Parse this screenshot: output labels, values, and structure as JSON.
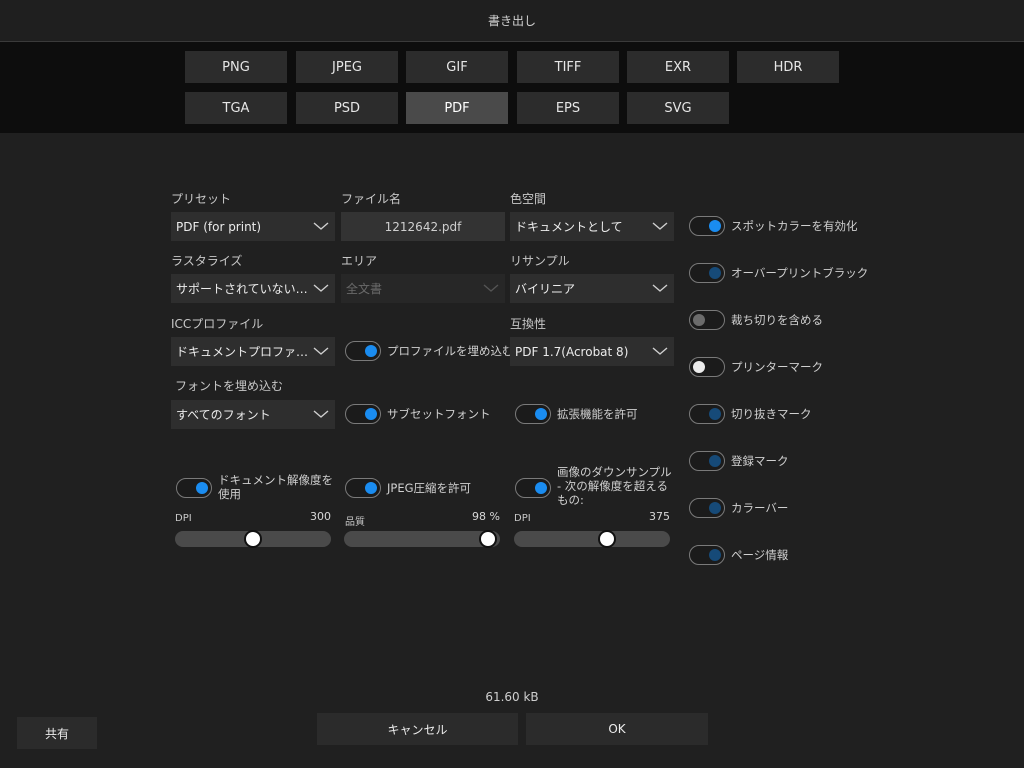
{
  "title": "書き出し",
  "formats": {
    "row1": [
      "PNG",
      "JPEG",
      "GIF",
      "TIFF",
      "EXR",
      "HDR"
    ],
    "row2": [
      "TGA",
      "PSD",
      "PDF",
      "EPS",
      "SVG"
    ],
    "selected": "PDF"
  },
  "preset": {
    "label": "プリセット",
    "value": "PDF (for print)"
  },
  "filename": {
    "label": "ファイル名",
    "value": "1212642.pdf"
  },
  "colorspace": {
    "label": "色空間",
    "value": "ドキュメントとして"
  },
  "rasterize": {
    "label": "ラスタライズ",
    "value": "サポートされていないプ…"
  },
  "area": {
    "label": "エリア",
    "value": "全文書"
  },
  "resample": {
    "label": "リサンプル",
    "value": "バイリニア"
  },
  "icc": {
    "label": "ICCプロファイル",
    "value": "ドキュメントプロファイ…"
  },
  "embed_profile": {
    "label": "プロファイルを埋め込む",
    "state": "on"
  },
  "compat": {
    "label": "互換性",
    "value": "PDF 1.7(Acrobat 8)"
  },
  "embed_fonts": {
    "label": "フォントを埋め込む",
    "value": "すべてのフォント"
  },
  "subset_fonts": {
    "label": "サブセットフォント",
    "state": "on"
  },
  "allow_ext": {
    "label": "拡張機能を許可",
    "state": "on"
  },
  "use_doc_res": {
    "label": "ドキュメント解像度を使用",
    "state": "on",
    "unit": "DPI",
    "value": "300",
    "fraction": 0.5
  },
  "jpeg": {
    "label": "JPEG圧縮を許可",
    "state": "on",
    "unit": "品質",
    "value": "98 %",
    "fraction": 0.98
  },
  "downsample": {
    "label": "画像のダウンサンプル - 次の解像度を超えるもの:",
    "state": "on",
    "unit": "DPI",
    "value": "375",
    "fraction": 0.61
  },
  "right_toggles": [
    {
      "label": "スポットカラーを有効化",
      "state": "on"
    },
    {
      "label": "オーバープリントブラック",
      "state": "on-dim"
    },
    {
      "label": "裁ち切りを含める",
      "state": "off"
    },
    {
      "label": "プリンターマーク",
      "state": "white"
    },
    {
      "label": "切り抜きマーク",
      "state": "on-dim"
    },
    {
      "label": "登録マーク",
      "state": "on-dim"
    },
    {
      "label": "カラーバー",
      "state": "on-dim"
    },
    {
      "label": "ページ情報",
      "state": "on-dim"
    }
  ],
  "file_size": "61.60 kB",
  "buttons": {
    "share": "共有",
    "cancel": "キャンセル",
    "ok": "OK"
  },
  "colors": {
    "accent": "#1a8cf0",
    "accent_dim": "#164a78",
    "panel": "#202020"
  }
}
